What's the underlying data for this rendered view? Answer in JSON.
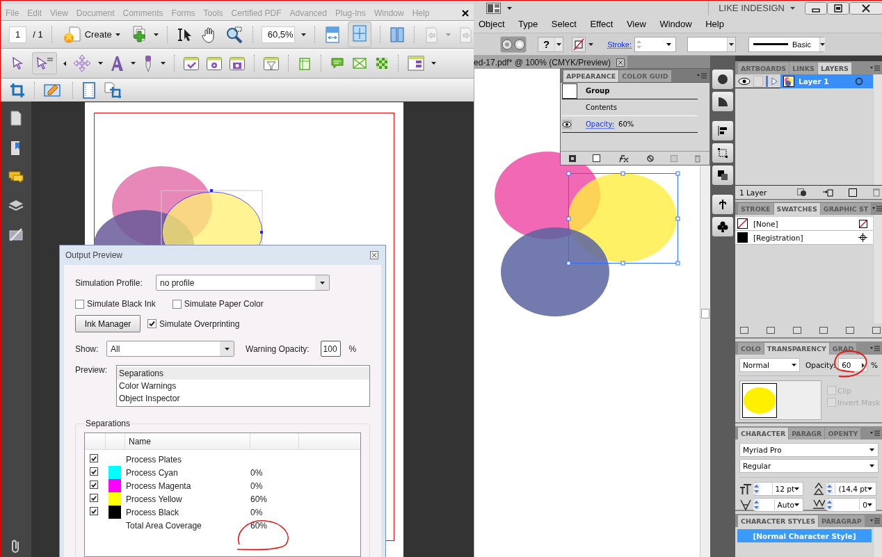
{
  "acrobat": {
    "menu": [
      "File",
      "Edit",
      "View",
      "Document",
      "Comments",
      "Forms",
      "Tools",
      "Certified PDF",
      "Advanced",
      "Plug-Ins",
      "Window",
      "Help"
    ],
    "page_number": "1",
    "page_count": "/ 1",
    "create_label": "Create",
    "zoom": "60,5%"
  },
  "output_preview": {
    "title": "Output Preview",
    "profile_label": "Simulation Profile:",
    "profile": "no profile",
    "options": [
      {
        "label": "Simulate Black Ink",
        "checked": false
      },
      {
        "label": "Simulate Paper Color",
        "checked": false
      }
    ],
    "ink_manager": "Ink Manager",
    "overprinting": {
      "label": "Simulate Overprinting",
      "checked": true
    },
    "show_label": "Show:",
    "show": "All",
    "warning_label": "Warning Opacity:",
    "warning_value": "100",
    "warning_unit": "%",
    "preview_label": "Preview:",
    "preview_items": [
      {
        "label": "Separations",
        "selected": true
      },
      {
        "label": "Color Warnings",
        "selected": false
      },
      {
        "label": "Object Inspector",
        "selected": false
      }
    ],
    "separations_title": "Separations",
    "name_column": "Name",
    "separations": [
      {
        "name": "Process Plates",
        "checked": true
      },
      {
        "name": "Process Cyan",
        "checked": true,
        "color": "#00ffff",
        "coverage": "0%"
      },
      {
        "name": "Process Magenta",
        "checked": true,
        "color": "#ff00ff",
        "coverage": "0%"
      },
      {
        "name": "Process Yellow",
        "checked": true,
        "color": "#ffff00",
        "coverage": "60%"
      },
      {
        "name": "Process Black",
        "checked": true,
        "color": "#000000",
        "coverage": "0%"
      }
    ],
    "total": {
      "label": "Total Area Coverage",
      "value": "60%"
    }
  },
  "illustrator": {
    "workspace": "LIKE INDESIGN",
    "menu": [
      "Object",
      "Type",
      "Select",
      "Effect",
      "View",
      "Window",
      "Help"
    ],
    "control": {
      "help_symbol": "?",
      "stroke_label": "Stroke:",
      "style": "Basic"
    },
    "document_tab": "ed-17.pdf* @ 100% (CMYK/Preview)",
    "appearance": {
      "tabs": [
        {
          "label": "APPEARANCE",
          "selected": true
        },
        {
          "label": "COLOR GUID",
          "selected": false
        }
      ],
      "object": "Group",
      "contents": "Contents",
      "attribute": "Opacity:",
      "attribute_value": "60%"
    },
    "layers": {
      "tabs": [
        {
          "label": "ARTBOARDS",
          "selected": false
        },
        {
          "label": "LINKS",
          "selected": false
        },
        {
          "label": "LAYERS",
          "selected": true
        }
      ],
      "layers": [
        {
          "name": "Layer 1",
          "selected": true
        }
      ],
      "count": "1 Layer"
    },
    "swatches": {
      "tabs": [
        {
          "label": "STROKE",
          "selected": false
        },
        {
          "label": "SWATCHES",
          "selected": true
        },
        {
          "label": "GRAPHIC ST",
          "selected": false
        }
      ],
      "items": [
        {
          "name": "[None]",
          "kind": "none"
        },
        {
          "name": "[Registration]",
          "kind": "registration"
        }
      ]
    },
    "transparency": {
      "tabs": [
        {
          "label": "COLO",
          "selected": false
        },
        {
          "label": "TRANSPARENCY",
          "selected": true
        },
        {
          "label": "GRAD",
          "selected": false
        }
      ],
      "mode": "Normal",
      "opacity_label": "Opacity:",
      "opacity": "60",
      "unit": "%",
      "options": [
        {
          "label": "Clip",
          "checked": false
        },
        {
          "label": "Invert Mask",
          "checked": false
        }
      ]
    },
    "character": {
      "tabs": [
        {
          "label": "CHARACTER",
          "selected": true
        },
        {
          "label": "PARAGR",
          "selected": false
        },
        {
          "label": "OPENTY",
          "selected": false
        }
      ],
      "font": "Myriad Pro",
      "style": "Regular",
      "size": "12 pt",
      "leading": "(14,4 pt",
      "kerning": "Auto",
      "tracking": "0"
    },
    "character_styles": {
      "tabs": [
        {
          "label": "CHARACTER STYLES",
          "selected": true
        },
        {
          "label": "PARAGRAP",
          "selected": false
        }
      ],
      "items": [
        {
          "name": "[Normal Character Style]",
          "selected": true
        }
      ]
    }
  }
}
